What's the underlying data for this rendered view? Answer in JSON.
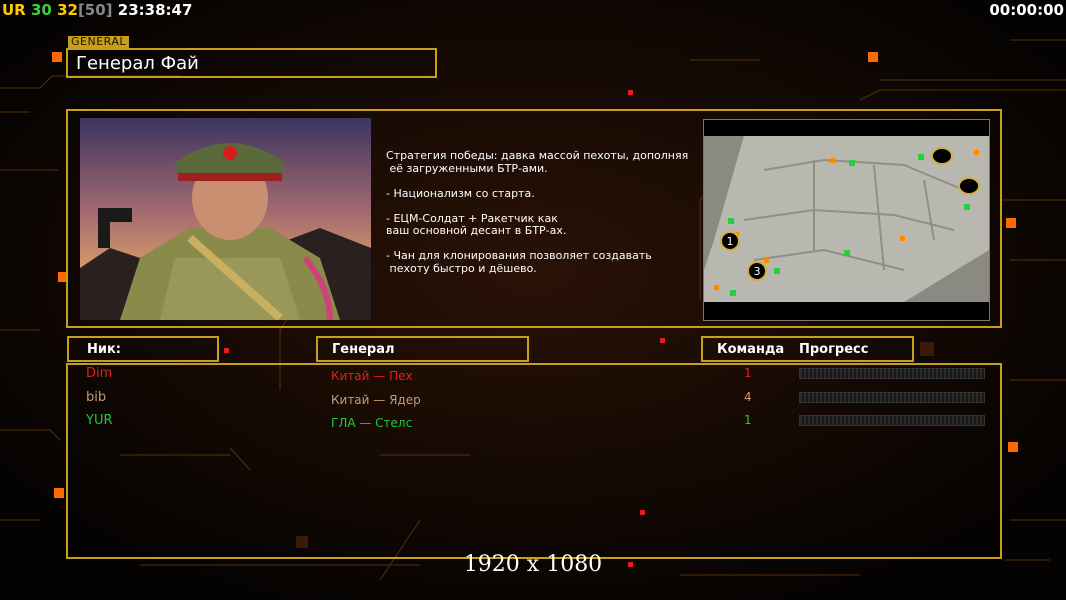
{
  "hud": {
    "prefix": "UR",
    "fps": "30",
    "fps2": "32",
    "bracket": "[50]",
    "clock": "23:38:47",
    "timer": "00:00:00"
  },
  "general_tag": "GENERAL",
  "general_name": "Генерал Фай",
  "strategy_lines": [
    "Стратегия победы: давка массой пехоты, дополняя",
    " её загруженными БТР-ами.",
    "",
    "- Национализм со старта.",
    "",
    "- ЕЦМ-Солдат + Ракетчик как",
    "ваш основной десант в БТР-ах.",
    "",
    "- Чан для клонирования позволяет создавать",
    " пехоту быстро и дёшево."
  ],
  "minimap": {
    "markers": [
      "1",
      "3"
    ]
  },
  "columns": {
    "nick": "Ник:",
    "general": "Генерал",
    "team": "Команда",
    "progress": "Прогресс"
  },
  "players": [
    {
      "nick": "Dim",
      "general": "Китай — Пех",
      "team": "1",
      "progress": 0.0,
      "color": "#e02020",
      "general_color": "#e02020"
    },
    {
      "nick": "bib",
      "general": "Китай — Ядер",
      "team": "4",
      "progress": 0.0,
      "color": "#c89a78",
      "general_color": "#c89a78"
    },
    {
      "nick": "YUR",
      "general": "ГЛА — Стелс",
      "team": "1",
      "progress": 0.0,
      "color": "#22c83c",
      "general_color": "#22c83c"
    }
  ],
  "resolution": "1920 x 1080",
  "colors": {
    "frame": "#c8a018",
    "accent_orange": "#ff6a00"
  }
}
